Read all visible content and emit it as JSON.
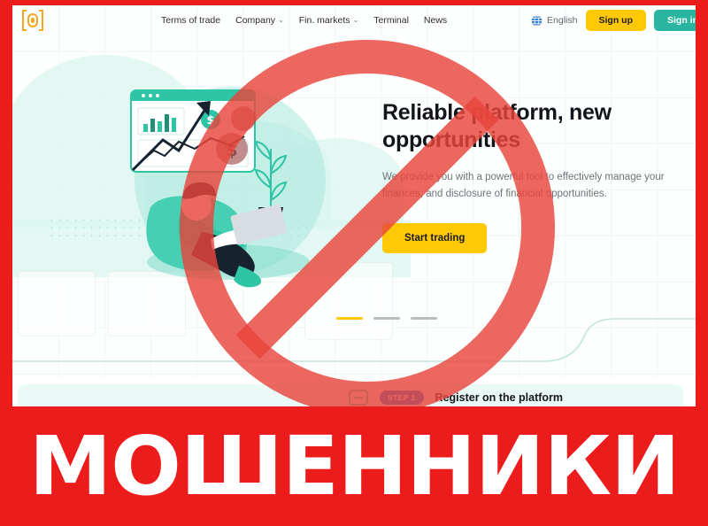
{
  "overlay": {
    "warning_text": "МОШЕННИКИ",
    "warning_bg_color": "#ec1c1c",
    "warning_text_color": "#ffffff",
    "prohibition_sign_color": "#e8453c",
    "frame_color": "#ec1c1c"
  },
  "navbar": {
    "logo_name": "brand-logo-icon",
    "logo_color": "#f5a623",
    "links": [
      {
        "label": "Terms of trade",
        "has_caret": false
      },
      {
        "label": "Company",
        "has_caret": true
      },
      {
        "label": "Fin. markets",
        "has_caret": true
      },
      {
        "label": "Terminal",
        "has_caret": false
      },
      {
        "label": "News",
        "has_caret": false
      }
    ],
    "caret_glyph": "⌄",
    "language": {
      "label": "English",
      "icon": "globe-icon"
    },
    "signup_label": "Sign up",
    "signup_color": "#ffc907",
    "signin_label": "Sign in",
    "signin_color": "#2ab5a0"
  },
  "hero": {
    "title": "Reliable platform, new opportunities",
    "subtitle": "We provide you with a powerful tool to effectively manage your finances, and disclosure of financial opportunities.",
    "cta_label": "Start trading",
    "cta_color": "#ffc907",
    "illustration_name": "trader-on-beanbag-illustration",
    "illustration_accent": "#2ec4a6"
  },
  "carousel": {
    "slides": [
      {
        "state": "active"
      },
      {
        "state": "idle"
      },
      {
        "state": "idle"
      }
    ],
    "active_color": "#ffc907",
    "idle_color": "#b9bcbf"
  },
  "steps": {
    "panel_color": "#eafaf7",
    "items": [
      {
        "badge": "STEP 1",
        "badge_color": "#1f72d6",
        "text": "Register on the platform",
        "icon": "document-icon"
      }
    ]
  }
}
